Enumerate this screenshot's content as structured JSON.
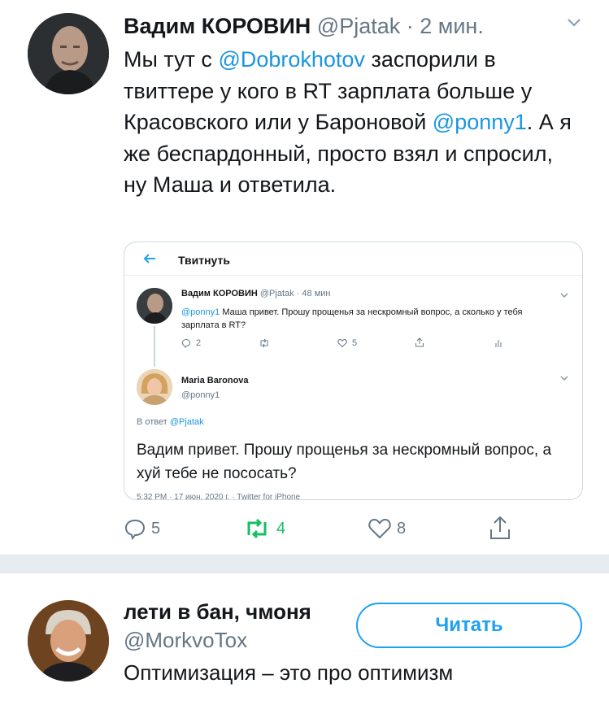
{
  "tweet": {
    "author_name": "Вадим КОРОВИН",
    "handle": "@Pjatak",
    "time": "2 мин.",
    "text_parts": [
      {
        "t": "Мы тут с "
      },
      {
        "t": "@Dobrokhotov",
        "link": true
      },
      {
        "t": " заспорили в твиттере у кого в RT зарплата больше у Красовского или у Бароновой "
      },
      {
        "t": "@ponny1",
        "link": true
      },
      {
        "t": ". А я же беспардонный, просто взял и спросил, ну Маша и ответила."
      }
    ],
    "actions": {
      "replies": "5",
      "retweets": "4",
      "likes": "8"
    }
  },
  "embedded": {
    "header_title": "Твитнуть",
    "first_tweet": {
      "author_name": "Вадим КОРОВИН",
      "handle": "@Pjatak",
      "time": "48 мин",
      "mention": "@ponny1",
      "text": " Маша привет. Прошу прощенья за нескромный вопрос, а сколько у тебя зарплата в RT?",
      "replies": "2",
      "likes": "5"
    },
    "reply_tweet": {
      "author_name": "Maria Baronova",
      "handle": "@ponny1",
      "reply_label": "В ответ",
      "reply_handle": "@Pjatak",
      "text": "Вадим привет. Прошу прощенья за нескромный вопрос, а хуй тебе не пососать?",
      "meta": "5:32 PM · 17 июн. 2020 г. · Twitter for iPhone"
    }
  },
  "profile": {
    "name": "лети в бан, чмоня",
    "handle": "@MorkvoTox",
    "bio": "Оптимизация – это про оптимизм",
    "follow_label": "Читать"
  },
  "colors": {
    "link": "#1b95e0",
    "accent": "#1da1f2",
    "retweet": "#17bf63",
    "muted": "#657786"
  }
}
